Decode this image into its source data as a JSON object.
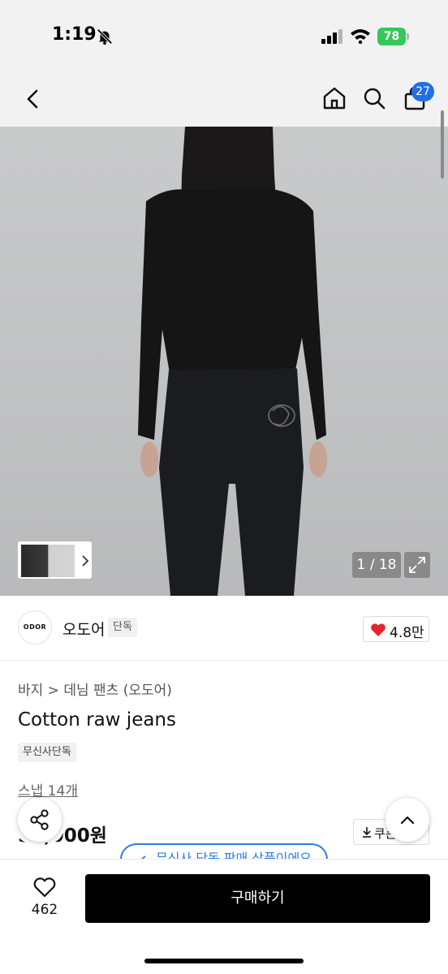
{
  "status_bar": {
    "time": "1:19",
    "battery": "78"
  },
  "header": {
    "cart_count": "27"
  },
  "gallery": {
    "counter": "1 / 18"
  },
  "brand": {
    "logo_text": "ODOR",
    "name": "오도어",
    "tag": "단독",
    "likes": "4.8만"
  },
  "product": {
    "breadcrumb": "바지 > 데님 팬츠 (오도어)",
    "title": "Cotton raw jeans",
    "badge": "무신사단독",
    "snap_link": "스냅 14개",
    "price": "59,000원",
    "coupon_label": "쿠폰",
    "notice": "무신사 단독 판매 상품이에요"
  },
  "bottom_bar": {
    "wish_count": "462",
    "buy_label": "구매하기"
  },
  "colors": {
    "accent_blue": "#1f6fe5",
    "heart_red": "#e5242d",
    "battery_green": "#35c759"
  }
}
